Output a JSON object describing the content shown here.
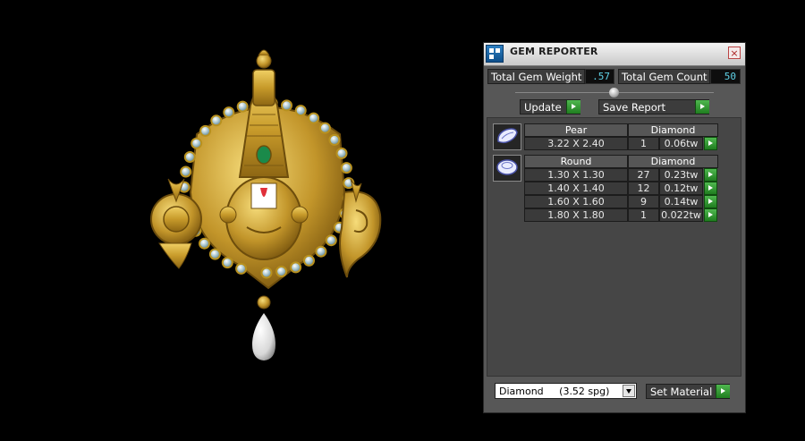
{
  "viewport": {
    "object": "gold-pendant-with-diamonds-and-pearl",
    "background_color": "#000000",
    "gold_color": "#c9a231",
    "emerald_color": "#1a8a4a"
  },
  "panel": {
    "title": "GEM REPORTER",
    "close_symbol": "×",
    "icon": "gem-reporter-app-icon",
    "total_gem_weight_label": "Total Gem Weight",
    "total_gem_weight_value": ".57",
    "total_gem_count_label": "Total Gem Count",
    "total_gem_count_value": "50",
    "update_label": "Update",
    "save_report_label": "Save Report",
    "groups": [
      {
        "shape": "Pear",
        "material": "Diamond",
        "icon": "pear-gem-icon",
        "rows": [
          {
            "size": "3.22 X 2.40",
            "count": "1",
            "weight": "0.06tw"
          }
        ]
      },
      {
        "shape": "Round",
        "material": "Diamond",
        "icon": "round-gem-icon",
        "rows": [
          {
            "size": "1.30 X 1.30",
            "count": "27",
            "weight": "0.23tw"
          },
          {
            "size": "1.40 X 1.40",
            "count": "12",
            "weight": "0.12tw"
          },
          {
            "size": "1.60 X 1.60",
            "count": "9",
            "weight": "0.14tw"
          },
          {
            "size": "1.80 X 1.80",
            "count": "1",
            "weight": "0.022tw"
          }
        ]
      }
    ],
    "material_select_value": "Diamond     (3.52 spg)",
    "set_material_label": "Set Material",
    "accent_green": "#2e9a2e"
  }
}
